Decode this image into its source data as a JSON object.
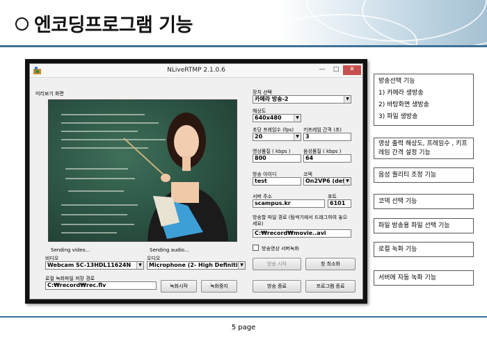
{
  "slide": {
    "title": "엔코딩프로그램 기능",
    "page": "5 page",
    "accent_color": "#3d6f95"
  },
  "window": {
    "title": "NLiveRTMP 2.1.0.6",
    "controls": {
      "minimize": "—",
      "maximize": "□",
      "close": "✕"
    },
    "preview_label": "미리보기 화면",
    "status_video": "Sending video...",
    "status_audio": "Sending audio...",
    "video": {
      "label": "비디오",
      "value": "Webcam SC-13HDL11624N"
    },
    "audio": {
      "label": "오디오",
      "value": "Microphone (2- High Definition"
    },
    "local_path": {
      "label": "로컬 녹화파일 저장 경로",
      "value": "C:₩record₩rec.flv"
    },
    "btn_record_start": "녹화시작",
    "btn_record_stop": "녹화중지",
    "device": {
      "label": "장치 선택",
      "value": "카메라 방송-2"
    },
    "resolution": {
      "label": "해상도",
      "value": "640x480"
    },
    "fps": {
      "label": "초당 프레임수 (fps)",
      "value": "20"
    },
    "keyframe": {
      "label": "키프레임 간격 (초)",
      "value": "3"
    },
    "video_quality": {
      "label": "영상품질 ( kbps )",
      "value": "800"
    },
    "audio_quality": {
      "label": "음성품질 ( kbps )",
      "value": "64"
    },
    "broadcast_id": {
      "label": "방송 아이디",
      "value": "test"
    },
    "codec": {
      "label": "코덱",
      "value": "On2VP6 (defa"
    },
    "server": {
      "label": "서버 주소",
      "value": "scampus.kr"
    },
    "port": {
      "label": "포트",
      "value": "6101"
    },
    "file_path": {
      "label": "방송할 파일 경로 (탐색기에서 드래그하여 놓으세요)",
      "value": "C:₩record₩movie..avi"
    },
    "server_record": {
      "label": "방송영상 서버녹화",
      "checked": false
    },
    "btn_broadcast_start": "방송 시작",
    "btn_minimize_window": "창 최소화",
    "btn_broadcast_end": "방송 종료",
    "btn_program_end": "프로그램 종료"
  },
  "notes": {
    "broadcast": {
      "title": "방송선택 기능",
      "items": [
        "1) 카메라 생방송",
        "2) 바탕화면 생방송",
        "3) 파일 생방송"
      ]
    },
    "output_settings": "영상 출력 해상도, 프레임수 , 키프레임 간격 설정 기능",
    "audio_quality": "음성 퀄리티 조정 기능",
    "codec_select": "코덱 선택 기능",
    "file_select": "파일 방송용 파일 선택 기능",
    "local_record": "로컬 녹화 기능",
    "server_record": "서버에 자동 녹화 기능"
  }
}
